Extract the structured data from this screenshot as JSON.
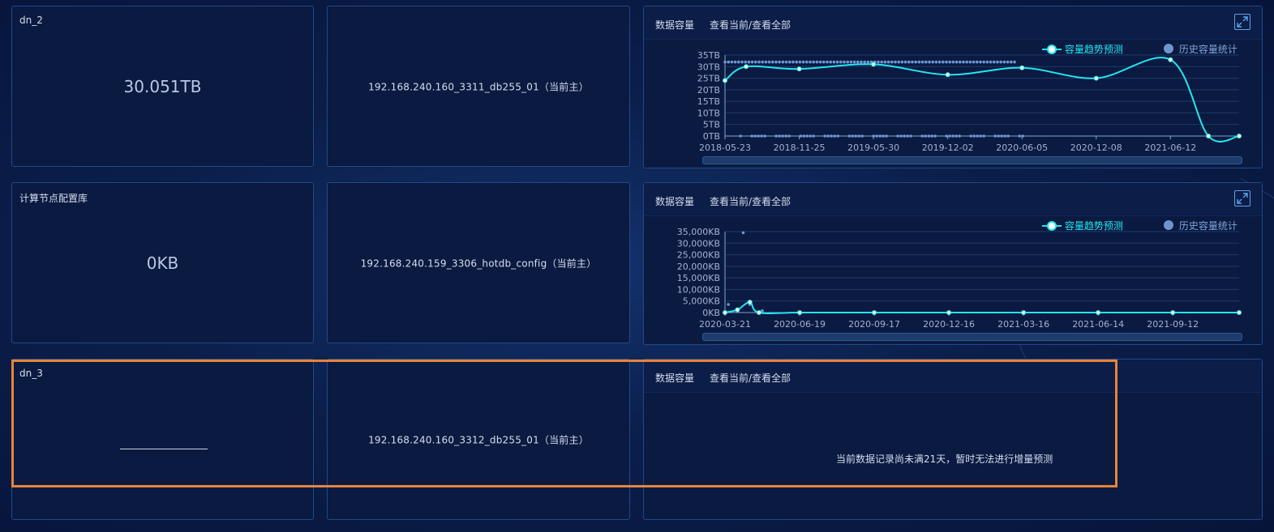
{
  "rows": [
    {
      "node_name": "dn_2",
      "capacity": "30.051TB",
      "instance": "192.168.240.160_3311_db255_01（当前主）",
      "chart_title": "数据容量",
      "chart_links": "查看当前/查看全部"
    },
    {
      "node_name": "计算节点配置库",
      "capacity": "0KB",
      "instance": "192.168.240.159_3306_hotdb_config（当前主）",
      "chart_title": "数据容量",
      "chart_links": "查看当前/查看全部"
    },
    {
      "node_name": "dn_3",
      "capacity": "",
      "instance": "192.168.240.160_3312_db255_01（当前主）",
      "chart_title": "数据容量",
      "chart_links": "查看当前/查看全部",
      "message": "当前数据记录尚未满21天，暂时无法进行增量预测"
    }
  ],
  "legend": {
    "trend": "容量趋势预测",
    "history": "历史容量统计"
  },
  "colors": {
    "trend": "#22e7f2",
    "history": "#6f95d0",
    "highlight": "#e8843a"
  },
  "icons": {
    "expand": "expand-icon"
  },
  "chart_data": [
    {
      "type": "line",
      "x_type": "date",
      "x_ticks": [
        "2018-05-23",
        "2018-11-25",
        "2019-05-30",
        "2019-12-02",
        "2020-06-05",
        "2020-12-08",
        "2021-06-12"
      ],
      "y_ticks": [
        "0TB",
        "5TB",
        "10TB",
        "15TB",
        "20TB",
        "25TB",
        "30TB",
        "35TB"
      ],
      "ylim": [
        0,
        35
      ],
      "y_unit": "TB",
      "series": [
        {
          "name": "容量趋势预测",
          "style": "line",
          "points": [
            [
              "2018-05-23",
              24
            ],
            [
              "2018-07-15",
              30
            ],
            [
              "2018-11-25",
              29
            ],
            [
              "2019-05-30",
              31
            ],
            [
              "2019-12-02",
              26.5
            ],
            [
              "2020-06-05",
              29.5
            ],
            [
              "2020-12-08",
              25
            ],
            [
              "2021-06-12",
              33
            ],
            [
              "2021-09-15",
              0
            ],
            [
              "2021-12-01",
              0
            ]
          ]
        },
        {
          "name": "历史容量统计",
          "style": "scatter",
          "upper_band": {
            "from": "2018-05-23",
            "to": "2020-05-20",
            "value": 32
          },
          "lower_band": {
            "from": "2018-07-01",
            "to": "2020-06-10",
            "value": 0
          }
        }
      ]
    },
    {
      "type": "line",
      "x_type": "date",
      "x_ticks": [
        "2020-03-21",
        "2020-06-19",
        "2020-09-17",
        "2020-12-16",
        "2021-03-16",
        "2021-06-14",
        "2021-09-12"
      ],
      "y_ticks": [
        "0KB",
        "5,000KB",
        "10,000KB",
        "15,000KB",
        "20,000KB",
        "25,000KB",
        "30,000KB",
        "35,000KB"
      ],
      "ylim": [
        0,
        35000
      ],
      "y_unit": "KB",
      "series": [
        {
          "name": "容量趋势预测",
          "style": "line",
          "points": [
            [
              "2020-03-21",
              0
            ],
            [
              "2020-04-05",
              1200
            ],
            [
              "2020-04-20",
              4500
            ],
            [
              "2020-05-01",
              0
            ],
            [
              "2020-06-19",
              0
            ],
            [
              "2020-09-17",
              0
            ],
            [
              "2020-12-16",
              0
            ],
            [
              "2021-03-16",
              0
            ],
            [
              "2021-06-14",
              0
            ],
            [
              "2021-09-12",
              0
            ],
            [
              "2021-12-01",
              0
            ]
          ]
        },
        {
          "name": "历史容量统计",
          "style": "scatter",
          "points": [
            [
              "2020-03-25",
              3500
            ],
            [
              "2020-04-12",
              34500
            ],
            [
              "2020-04-20",
              3500
            ],
            [
              "2020-05-05",
              800
            ]
          ]
        }
      ]
    }
  ]
}
